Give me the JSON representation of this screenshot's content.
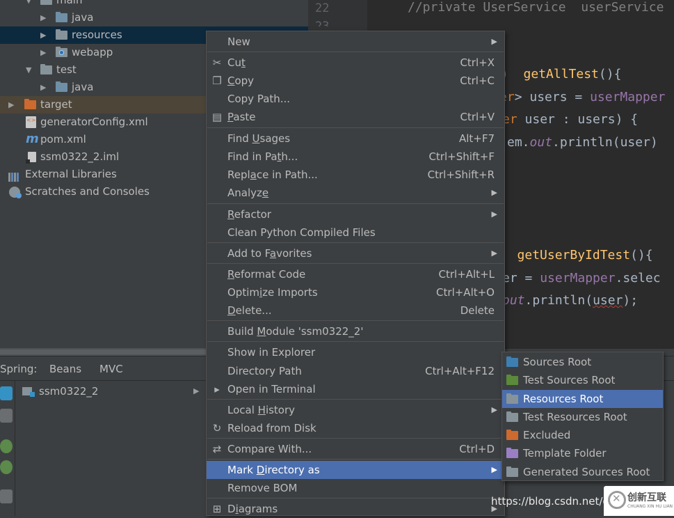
{
  "project_tree": {
    "items": [
      {
        "label": "main",
        "kind": "folder"
      },
      {
        "label": "java",
        "kind": "source-folder"
      },
      {
        "label": "resources",
        "kind": "folder",
        "selected": true
      },
      {
        "label": "webapp",
        "kind": "web-folder"
      },
      {
        "label": "test",
        "kind": "folder"
      },
      {
        "label": "java",
        "kind": "source-folder"
      },
      {
        "label": "target",
        "kind": "excluded-folder"
      },
      {
        "label": "generatorConfig.xml",
        "kind": "xml-file"
      },
      {
        "label": "pom.xml",
        "kind": "maven-file"
      },
      {
        "label": "ssm0322_2.iml",
        "kind": "iml-file"
      },
      {
        "label": "External Libraries",
        "kind": "libraries"
      },
      {
        "label": "Scratches and Consoles",
        "kind": "scratches"
      }
    ]
  },
  "editor": {
    "line_numbers": [
      "22",
      "23"
    ],
    "lines": [
      {
        "segments": [
          [
            "comment",
            "//private UserService  userService"
          ]
        ]
      },
      {
        "segments": [
          [
            "kw",
            ")  "
          ],
          [
            "fn",
            "getAllTest"
          ],
          [
            "plain",
            "(){"
          ]
        ]
      },
      {
        "segments": [
          [
            "kw",
            "er"
          ],
          [
            "plain",
            "> users = "
          ],
          [
            "ref",
            "userMapper"
          ]
        ]
      },
      {
        "segments": [
          [
            "kw",
            "er"
          ],
          [
            "plain",
            " user : users) {"
          ]
        ]
      },
      {
        "segments": [
          [
            "plain",
            "em."
          ],
          [
            "field",
            "out"
          ],
          [
            "plain",
            ".println(user)"
          ]
        ]
      },
      {
        "segments": [
          [
            "kw",
            ")  "
          ],
          [
            "fn",
            "getUserByIdTest"
          ],
          [
            "plain",
            "(){"
          ]
        ]
      },
      {
        "segments": [
          [
            "plain",
            "er = "
          ],
          [
            "ref",
            "userMapper"
          ],
          [
            "plain",
            ".selec"
          ]
        ]
      },
      {
        "segments": [
          [
            "field",
            "out"
          ],
          [
            "plain",
            ".println("
          ],
          [
            "wave",
            "user"
          ],
          [
            "plain",
            ");"
          ]
        ]
      }
    ]
  },
  "spring_panel": {
    "label": "Spring:",
    "tabs": [
      "Beans",
      "MVC"
    ],
    "module": "ssm0322_2"
  },
  "context_menu": {
    "items": [
      {
        "label": "New",
        "submenu": true
      },
      {
        "label": "Cut",
        "shortcut": "Ctrl+X",
        "icon": "scissors-icon",
        "glyph": "✂"
      },
      {
        "label": "Copy",
        "shortcut": "Ctrl+C",
        "icon": "copy-icon",
        "glyph": "❐"
      },
      {
        "label": "Copy Path..."
      },
      {
        "label": "Paste",
        "shortcut": "Ctrl+V",
        "icon": "clipboard-icon",
        "glyph": "▤"
      },
      {
        "label": "Find Usages",
        "shortcut": "Alt+F7"
      },
      {
        "label": "Find in Path...",
        "shortcut": "Ctrl+Shift+F"
      },
      {
        "label": "Replace in Path...",
        "shortcut": "Ctrl+Shift+R"
      },
      {
        "label": "Analyze",
        "submenu": true
      },
      {
        "label": "Refactor",
        "submenu": true
      },
      {
        "label": "Clean Python Compiled Files"
      },
      {
        "label": "Add to Favorites",
        "submenu": true
      },
      {
        "label": "Reformat Code",
        "shortcut": "Ctrl+Alt+L"
      },
      {
        "label": "Optimize Imports",
        "shortcut": "Ctrl+Alt+O"
      },
      {
        "label": "Delete...",
        "shortcut": "Delete"
      },
      {
        "label": "Build Module 'ssm0322_2'"
      },
      {
        "label": "Show in Explorer"
      },
      {
        "label": "Directory Path",
        "shortcut": "Ctrl+Alt+F12"
      },
      {
        "label": "Open in Terminal",
        "icon": "terminal-icon",
        "glyph": "▸"
      },
      {
        "label": "Local History",
        "submenu": true
      },
      {
        "label": "Reload from Disk",
        "icon": "reload-icon",
        "glyph": "↻"
      },
      {
        "label": "Compare With...",
        "shortcut": "Ctrl+D",
        "icon": "compare-icon",
        "glyph": "⇄"
      },
      {
        "label": "Mark Directory as",
        "submenu": true,
        "highlighted": true
      },
      {
        "label": "Remove BOM"
      },
      {
        "label": "Diagrams",
        "submenu": true,
        "icon": "diagram-icon",
        "glyph": "⊞"
      }
    ]
  },
  "submenu": {
    "items": [
      {
        "label": "Sources Root",
        "color": "#3d7fb0"
      },
      {
        "label": "Test Sources Root",
        "color": "#5a8a3a"
      },
      {
        "label": "Resources Root",
        "color": "#87939a",
        "highlighted": true
      },
      {
        "label": "Test Resources Root",
        "color": "#87939a"
      },
      {
        "label": "Excluded",
        "color": "#cc6a2f"
      },
      {
        "label": "Template Folder",
        "color": "#9a7fc4"
      },
      {
        "label": "Generated Sources Root",
        "color": "#87939a"
      }
    ]
  },
  "watermark": {
    "url": "https://blog.csdn.net/gq",
    "brand_cn": "创新互联",
    "brand_en": "CHUANG XIN HU LIAN"
  }
}
